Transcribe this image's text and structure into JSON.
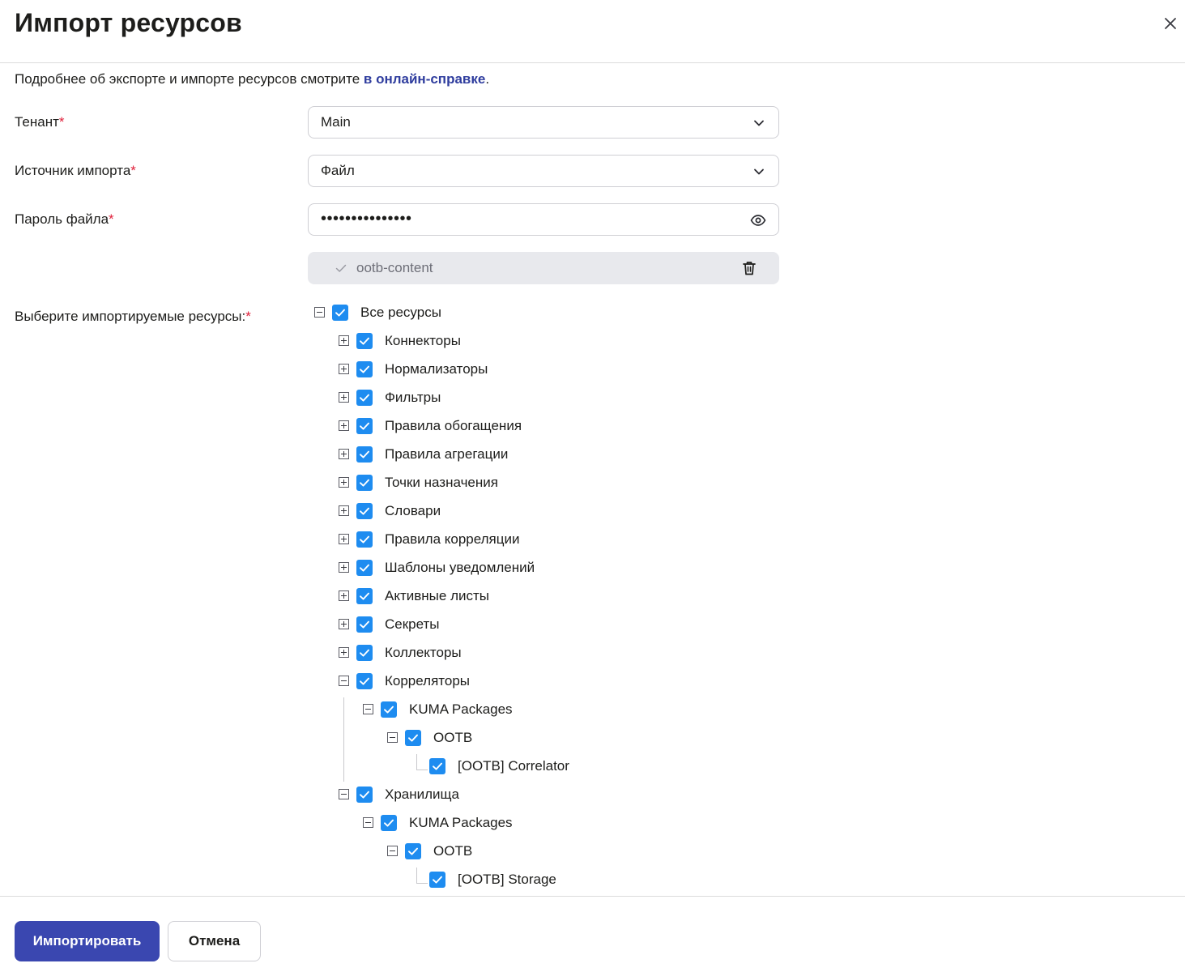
{
  "dialog": {
    "title": "Импорт ресурсов",
    "close_icon": "close-icon"
  },
  "info": {
    "text_before": "Подробнее об экспорте и импорте ресурсов смотрите ",
    "link_text": "в онлайн-справке",
    "text_after": "."
  },
  "form": {
    "required_mark": "*",
    "tenant": {
      "label": "Тенант",
      "value": "Main"
    },
    "source": {
      "label": "Источник импорта",
      "value": "Файл"
    },
    "password": {
      "label": "Пароль файла",
      "masked_value": "•••••••••••••••",
      "icon": "eye-icon"
    },
    "file": {
      "name": "ootb-content",
      "icons": [
        "check-icon",
        "trash-icon"
      ]
    },
    "resources_label": "Выберите импортируемые ресурсы:"
  },
  "tree": [
    {
      "label": "Все ресурсы",
      "level": 0,
      "toggle": "minus",
      "checked": true
    },
    {
      "label": "Коннекторы",
      "level": 1,
      "toggle": "plus",
      "checked": true
    },
    {
      "label": "Нормализаторы",
      "level": 1,
      "toggle": "plus",
      "checked": true
    },
    {
      "label": "Фильтры",
      "level": 1,
      "toggle": "plus",
      "checked": true
    },
    {
      "label": "Правила обогащения",
      "level": 1,
      "toggle": "plus",
      "checked": true
    },
    {
      "label": "Правила агрегации",
      "level": 1,
      "toggle": "plus",
      "checked": true
    },
    {
      "label": "Точки назначения",
      "level": 1,
      "toggle": "plus",
      "checked": true
    },
    {
      "label": "Словари",
      "level": 1,
      "toggle": "plus",
      "checked": true
    },
    {
      "label": "Правила корреляции",
      "level": 1,
      "toggle": "plus",
      "checked": true
    },
    {
      "label": "Шаблоны уведомлений",
      "level": 1,
      "toggle": "plus",
      "checked": true
    },
    {
      "label": "Активные листы",
      "level": 1,
      "toggle": "plus",
      "checked": true
    },
    {
      "label": "Секреты",
      "level": 1,
      "toggle": "plus",
      "checked": true
    },
    {
      "label": "Коллекторы",
      "level": 1,
      "toggle": "plus",
      "checked": true
    },
    {
      "label": "Корреляторы",
      "level": 1,
      "toggle": "minus",
      "checked": true
    },
    {
      "label": "KUMA Packages",
      "level": 2,
      "toggle": "minus",
      "checked": true
    },
    {
      "label": "OOTB",
      "level": 3,
      "toggle": "minus",
      "checked": true
    },
    {
      "label": "[OOTB] Correlator",
      "level": 4,
      "toggle": "leaf",
      "checked": true
    },
    {
      "label": "Хранилища",
      "level": 1,
      "toggle": "minus",
      "checked": true
    },
    {
      "label": "KUMA Packages",
      "level": 2,
      "toggle": "minus",
      "checked": true
    },
    {
      "label": "OOTB",
      "level": 3,
      "toggle": "minus",
      "checked": true
    },
    {
      "label": "[OOTB] Storage",
      "level": 4,
      "toggle": "leaf",
      "checked": true
    }
  ],
  "footer": {
    "import_label": "Импортировать",
    "cancel_label": "Отмена"
  },
  "colors": {
    "primary": "#3a47b0",
    "checkbox": "#1e8cf0",
    "link": "#2f3d9e",
    "required": "#e0213b"
  }
}
